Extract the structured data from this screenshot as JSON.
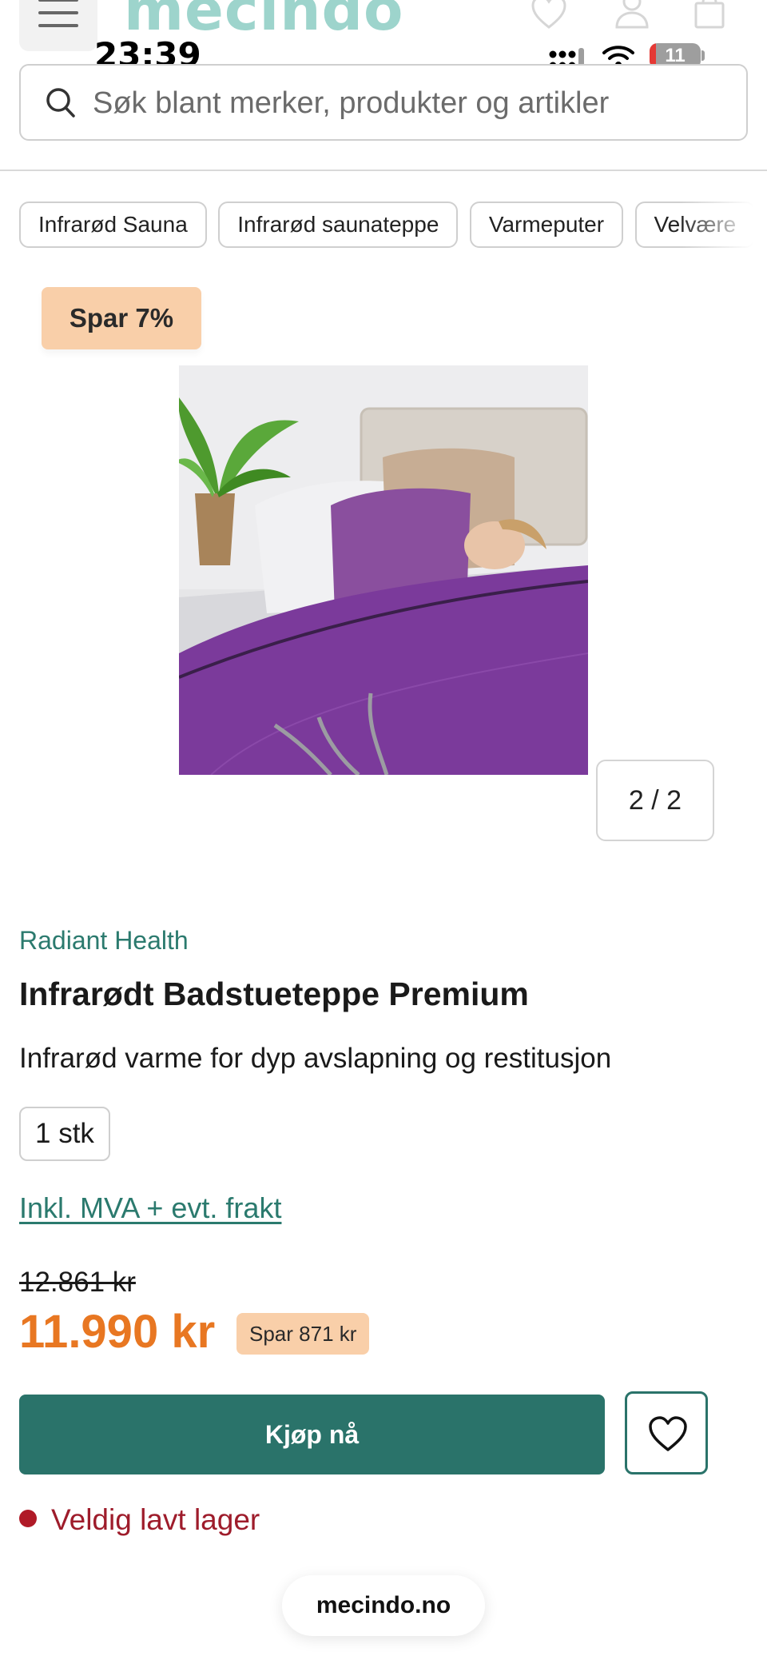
{
  "header": {
    "logo": "mecindo"
  },
  "status_bar": {
    "time": "23:39",
    "battery": "11"
  },
  "search": {
    "placeholder": "Søk blant merker, produkter og artikler"
  },
  "categories": [
    "Infrarød Sauna",
    "Infrarød saunateppe",
    "Varmeputer",
    "Velvære"
  ],
  "gallery": {
    "badge": "Spar 7%",
    "counter": "2 / 2"
  },
  "product": {
    "brand": "Radiant Health",
    "title": "Infrarødt Badstueteppe Premium",
    "subtitle": "Infrarød varme for dyp avslapning og restitusjon",
    "variant": "1 stk",
    "vat_note": "Inkl. MVA + evt. frakt",
    "old_price": "12.861 kr",
    "price": "11.990 kr",
    "savings": "Spar 871 kr",
    "buy_label": "Kjøp nå",
    "stock_status": "Veldig lavt lager"
  },
  "browser": {
    "url": "mecindo.no"
  },
  "colors": {
    "brand_teal": "#2a736a",
    "price_orange": "#e87722",
    "badge_peach": "#f9cfa9",
    "stock_red": "#9e1c2b"
  }
}
